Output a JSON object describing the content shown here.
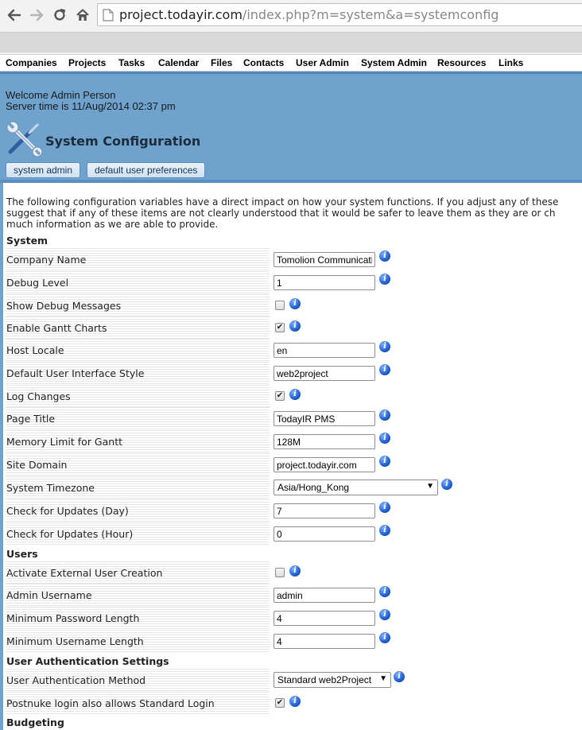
{
  "browser": {
    "url_host": "project.todayir.com",
    "url_path": "/index.php?m=system&a=systemconfig"
  },
  "menu": [
    "Companies",
    "Projects",
    "Tasks",
    "Calendar",
    "Files",
    "Contacts",
    "User Admin",
    "System Admin",
    "Resources",
    "Links"
  ],
  "header": {
    "welcome": "Welcome Admin Person",
    "server_time": "Server time is 11/Aug/2014 02:37 pm",
    "title": "System Configuration",
    "crumbs": [
      "system admin",
      "default user preferences"
    ]
  },
  "intro": [
    "The following configuration variables have a direct impact on how your system functions. If you adjust any of these",
    "suggest that if any of these items are not clearly understood that it would be safer to leave them as they are or ch",
    "much information as we are able to provide."
  ],
  "sections": {
    "system": "System",
    "users": "Users",
    "auth": "User Authentication Settings",
    "budgeting": "Budgeting"
  },
  "settings": {
    "company_name": {
      "label": "Company Name",
      "value": "Tomolion Communications"
    },
    "debug_level": {
      "label": "Debug Level",
      "value": "1"
    },
    "show_debug": {
      "label": "Show Debug Messages",
      "checked": false
    },
    "gantt": {
      "label": "Enable Gantt Charts",
      "checked": true
    },
    "host_locale": {
      "label": "Host Locale",
      "value": "en"
    },
    "ui_style": {
      "label": "Default User Interface Style",
      "value": "web2project"
    },
    "log_changes": {
      "label": "Log Changes",
      "checked": true
    },
    "page_title": {
      "label": "Page Title",
      "value": "TodayIR PMS"
    },
    "memory_limit": {
      "label": "Memory Limit for Gantt",
      "value": "128M"
    },
    "site_domain": {
      "label": "Site Domain",
      "value": "project.todayir.com"
    },
    "timezone": {
      "label": "System Timezone",
      "value": "Asia/Hong_Kong"
    },
    "updates_day": {
      "label": "Check for Updates (Day)",
      "value": "7"
    },
    "updates_hour": {
      "label": "Check for Updates (Hour)",
      "value": "0"
    },
    "ext_users": {
      "label": "Activate External User Creation",
      "checked": false
    },
    "admin_username": {
      "label": "Admin Username",
      "value": "admin"
    },
    "min_password": {
      "label": "Minimum Password Length",
      "value": "4"
    },
    "min_username": {
      "label": "Minimum Username Length",
      "value": "4"
    },
    "auth_method": {
      "label": "User Authentication Method",
      "value": "Standard web2Project"
    },
    "postnuke": {
      "label": "Postnuke login also allows Standard Login",
      "checked": true
    }
  },
  "icons": {
    "info": "info-icon",
    "wrench": "wrench-screwdriver-icon",
    "check_mark": "✔"
  },
  "colors": {
    "header_blue": "#6fa3cd",
    "info_blue": "#1f5fd0",
    "url_green_border": "#8fd07a"
  }
}
